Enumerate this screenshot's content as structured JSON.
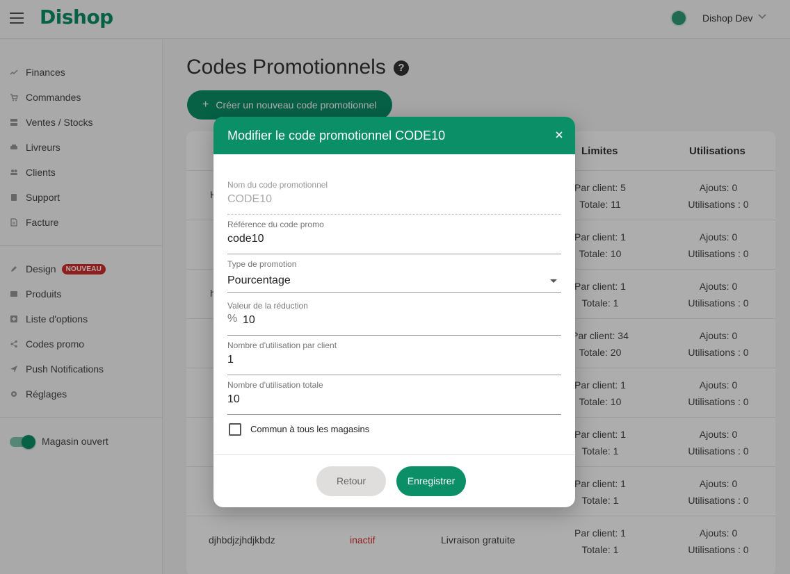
{
  "app": {
    "logo": "Dishop",
    "user_name": "Dishop Dev"
  },
  "sidebar": {
    "items": [
      {
        "label": "Finances",
        "icon": "trending-icon"
      },
      {
        "label": "Commandes",
        "icon": "cart-icon"
      },
      {
        "label": "Ventes / Stocks",
        "icon": "stack-icon"
      },
      {
        "label": "Livreurs",
        "icon": "car-icon"
      },
      {
        "label": "Clients",
        "icon": "people-icon"
      },
      {
        "label": "Support",
        "icon": "book-icon"
      },
      {
        "label": "Facture",
        "icon": "document-icon"
      }
    ],
    "items2": [
      {
        "label": "Design",
        "icon": "pencil-icon",
        "badge": "NOUVEAU"
      },
      {
        "label": "Produits",
        "icon": "box-icon"
      },
      {
        "label": "Liste d'options",
        "icon": "add-box-icon"
      },
      {
        "label": "Codes promo",
        "icon": "share-icon"
      },
      {
        "label": "Push Notifications",
        "icon": "send-icon"
      },
      {
        "label": "Réglages",
        "icon": "gear-icon"
      }
    ],
    "store_toggle_label": "Magasin ouvert",
    "store_open": true
  },
  "main": {
    "title": "Codes Promotionnels",
    "create_button": "Créer un nouveau code promotionnel",
    "table": {
      "headers": {
        "limits": "Limites",
        "usages": "Utilisations"
      },
      "rows": [
        {
          "name_fragment": "H",
          "limit_client": "Par client: 5",
          "limit_total": "Totale: 11",
          "adds": "Ajouts: 0",
          "uses": "Utilisations : 0"
        },
        {
          "limit_client": "Par client: 1",
          "limit_total": "Totale: 10",
          "adds": "Ajouts: 0",
          "uses": "Utilisations : 0"
        },
        {
          "name_fragment": "h",
          "limit_client": "Par client: 1",
          "limit_total": "Totale: 1",
          "adds": "Ajouts: 0",
          "uses": "Utilisations : 0"
        },
        {
          "limit_client": "Par client: 34",
          "limit_total": "Totale: 20",
          "adds": "Ajouts: 0",
          "uses": "Utilisations : 0"
        },
        {
          "limit_client": "Par client: 1",
          "limit_total": "Totale: 10",
          "adds": "Ajouts: 0",
          "uses": "Utilisations : 0"
        },
        {
          "limit_client": "Par client: 1",
          "limit_total": "Totale: 1",
          "adds": "Ajouts: 0",
          "uses": "Utilisations : 0"
        },
        {
          "limit_client": "Par client: 1",
          "limit_total": "Totale: 1",
          "adds": "Ajouts: 0",
          "uses": "Utilisations : 0"
        },
        {
          "name": "djhbdjzjhdjkbdz",
          "state": "inactif",
          "type": "Livraison gratuite",
          "limit_client": "Par client: 1",
          "limit_total": "Totale: 1",
          "adds": "Ajouts: 0",
          "uses": "Utilisations : 0"
        }
      ]
    }
  },
  "dialog": {
    "title": "Modifier le code promotionnel CODE10",
    "fields": {
      "name": {
        "label": "Nom du code promotionnel",
        "value": "CODE10"
      },
      "reference": {
        "label": "Référence du code promo",
        "value": "code10"
      },
      "type": {
        "label": "Type de promotion",
        "value": "Pourcentage"
      },
      "discount": {
        "label": "Valeur de la réduction",
        "prefix": "%",
        "value": "10"
      },
      "per_client": {
        "label": "Nombre d'utilisation par client",
        "value": "1"
      },
      "total": {
        "label": "Nombre d'utilisation totale",
        "value": "10"
      }
    },
    "checkbox_label": "Commun à tous les magasins",
    "checkbox_checked": false,
    "back_button": "Retour",
    "save_button": "Enregistrer"
  },
  "colors": {
    "brand": "#0a8f66",
    "danger": "#d32f2f"
  }
}
